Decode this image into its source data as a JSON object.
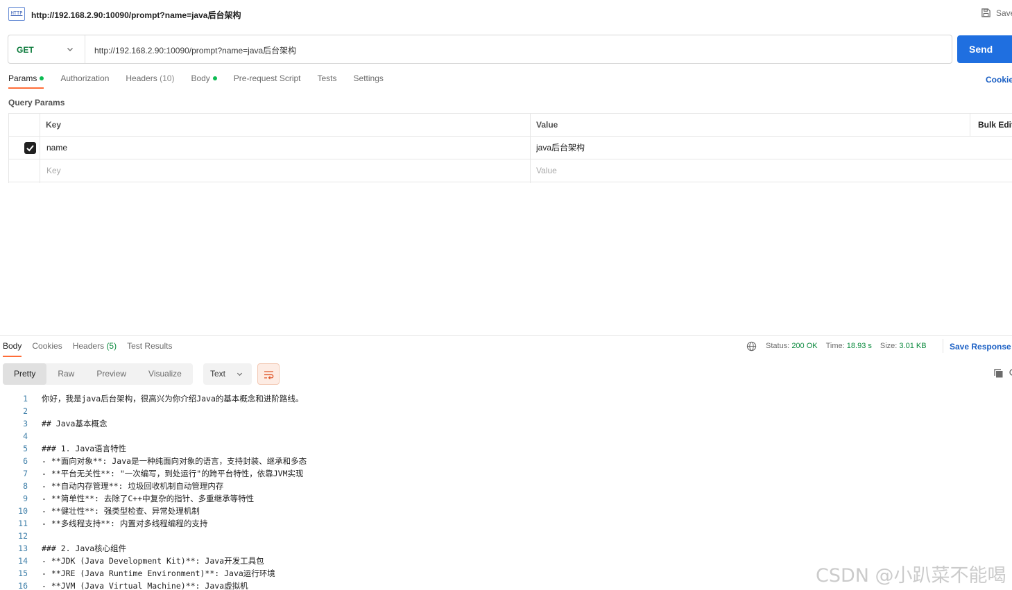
{
  "request": {
    "title": "http://192.168.2.90:10090/prompt?name=java后台架构",
    "save_label": "Save",
    "method": "GET",
    "url": "http://192.168.2.90:10090/prompt?name=java后台架构",
    "send_label": "Send"
  },
  "request_tabs": [
    {
      "label": "Params"
    },
    {
      "label": "Authorization"
    },
    {
      "label": "Headers",
      "count": "(10)"
    },
    {
      "label": "Body"
    },
    {
      "label": "Pre-request Script"
    },
    {
      "label": "Tests"
    },
    {
      "label": "Settings"
    }
  ],
  "cookies_label": "Cookies",
  "query_params": {
    "title": "Query Params",
    "headers": {
      "key": "Key",
      "value": "Value",
      "bulk": "Bulk Edit"
    },
    "rows": [
      {
        "key": "name",
        "value": "java后台架构",
        "checked": true
      }
    ],
    "placeholder": {
      "key": "Key",
      "value": "Value"
    }
  },
  "response_tabs": [
    {
      "label": "Body"
    },
    {
      "label": "Cookies"
    },
    {
      "label": "Headers",
      "count": "(5)"
    },
    {
      "label": "Test Results"
    }
  ],
  "response_status": {
    "status_label": "Status:",
    "status": "200 OK",
    "time_label": "Time:",
    "time": "18.93 s",
    "size_label": "Size:",
    "size": "3.01 KB",
    "save_response": "Save Response"
  },
  "view_modes": [
    "Pretty",
    "Raw",
    "Preview",
    "Visualize"
  ],
  "format": "Text",
  "body_lines": [
    {
      "n": "1",
      "text": "你好，我是java后台架构，很高兴为你介绍Java的基本概念和进阶路线。"
    },
    {
      "n": "2",
      "text": ""
    },
    {
      "n": "3",
      "text": "## Java基本概念"
    },
    {
      "n": "4",
      "text": ""
    },
    {
      "n": "5",
      "text": "### 1. Java语言特性"
    },
    {
      "n": "6",
      "text": "- **面向对象**: Java是一种纯面向对象的语言，支持封装、继承和多态"
    },
    {
      "n": "7",
      "text": "- **平台无关性**: \"一次编写，到处运行\"的跨平台特性，依靠JVM实现"
    },
    {
      "n": "8",
      "text": "- **自动内存管理**: 垃圾回收机制自动管理内存"
    },
    {
      "n": "9",
      "text": "- **简单性**: 去除了C++中复杂的指针、多重继承等特性"
    },
    {
      "n": "10",
      "text": "- **健壮性**: 强类型检查、异常处理机制"
    },
    {
      "n": "11",
      "text": "- **多线程支持**: 内置对多线程编程的支持"
    },
    {
      "n": "12",
      "text": ""
    },
    {
      "n": "13",
      "text": "### 2. Java核心组件"
    },
    {
      "n": "14",
      "text": "- **JDK (Java Development Kit)**: Java开发工具包"
    },
    {
      "n": "15",
      "text": "- **JRE (Java Runtime Environment)**: Java运行环境"
    },
    {
      "n": "16",
      "text": "- **JVM (Java Virtual Machine)**: Java虚拟机"
    }
  ],
  "watermark": "CSDN @小趴菜不能喝",
  "colors": {
    "accent": "#ff6c37",
    "send": "#1f6fe0",
    "link": "#1a5fc4",
    "get": "#0b7a3b",
    "status_ok": "#0b8a3e"
  },
  "icons": [
    "http-icon",
    "save-icon",
    "chevron-down-icon",
    "checkbox-checked-icon",
    "globe-icon",
    "wrap-lines-icon",
    "copy-icon",
    "search-icon"
  ]
}
